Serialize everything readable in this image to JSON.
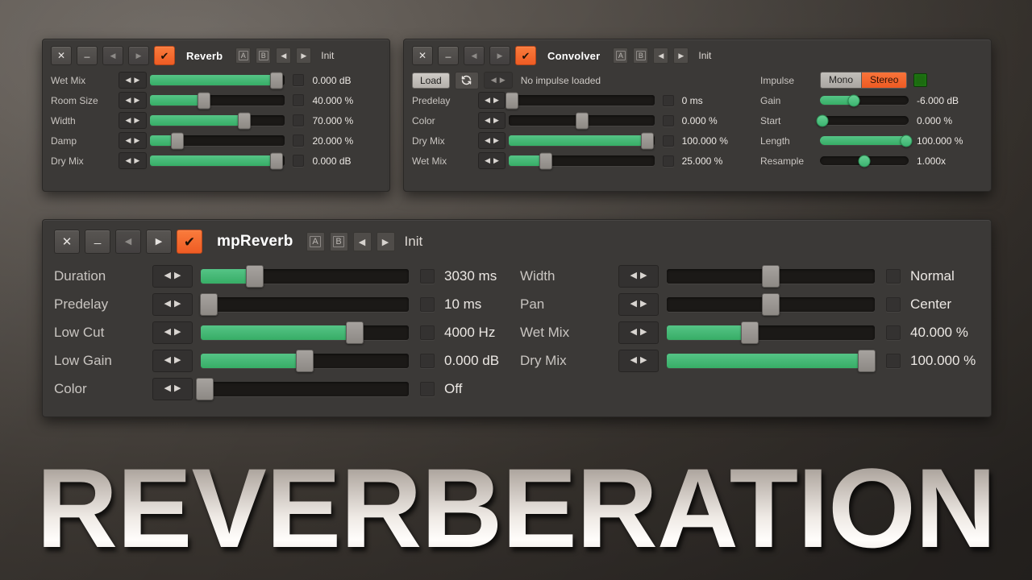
{
  "theme": {
    "accent_orange": "#ef5c24",
    "slider_green": "#3fb56e",
    "panel_bg": "#3b3937",
    "track_bg": "#1b1917",
    "led_green": "#1d6b10"
  },
  "hero": {
    "title": "REVERBERATION"
  },
  "panels": [
    {
      "id": "reverb",
      "name": "Reverb",
      "titlebar": {
        "close": "✕",
        "minimize": "_",
        "prev": "◀",
        "next": "▶",
        "enabled_check": "✔",
        "a_label": "A",
        "b_label": "B",
        "preset_prev": "◀",
        "preset_next": "▶",
        "preset_name": "Init"
      },
      "params": [
        {
          "label": "Wet Mix",
          "value": "0.000 dB",
          "fill_pct": 94,
          "thumb_pct": 94
        },
        {
          "label": "Room Size",
          "value": "40.000 %",
          "fill_pct": 40,
          "thumb_pct": 40
        },
        {
          "label": "Width",
          "value": "70.000 %",
          "fill_pct": 70,
          "thumb_pct": 70
        },
        {
          "label": "Damp",
          "value": "20.000 %",
          "fill_pct": 20,
          "thumb_pct": 20
        },
        {
          "label": "Dry Mix",
          "value": "0.000 dB",
          "fill_pct": 94,
          "thumb_pct": 94
        }
      ]
    },
    {
      "id": "convolver",
      "name": "Convolver",
      "titlebar": {
        "close": "✕",
        "minimize": "_",
        "prev": "◀",
        "next": "▶",
        "enabled_check": "✔",
        "a_label": "A",
        "b_label": "B",
        "preset_prev": "◀",
        "preset_next": "▶",
        "preset_name": "Init"
      },
      "load_row": {
        "load_label": "Load",
        "reload_icon": "reload-icon",
        "prev": "◀",
        "next": "▶",
        "impulse_status": "No impulse loaded"
      },
      "params": [
        {
          "label": "Predelay",
          "value": "0 ms",
          "fill_pct": 0,
          "thumb_pct": 2
        },
        {
          "label": "Color",
          "value": "0.000 %",
          "fill_pct": 0,
          "thumb_pct": 50
        },
        {
          "label": "Dry Mix",
          "value": "100.000 %",
          "fill_pct": 95,
          "thumb_pct": 95
        },
        {
          "label": "Wet Mix",
          "value": "25.000 %",
          "fill_pct": 25,
          "thumb_pct": 25
        }
      ],
      "impulse": {
        "label": "Impulse",
        "mono_label": "Mono",
        "stereo_label": "Stereo",
        "selected": "Stereo",
        "led": "stereo-led"
      },
      "right_params": [
        {
          "label": "Gain",
          "value": "-6.000 dB",
          "fill_pct": 38,
          "thumb_pct": 38
        },
        {
          "label": "Start",
          "value": "0.000 %",
          "fill_pct": 3,
          "thumb_pct": 3
        },
        {
          "label": "Length",
          "value": "100.000 %",
          "fill_pct": 97,
          "thumb_pct": 97
        },
        {
          "label": "Resample",
          "value": "1.000x",
          "fill_pct": 0,
          "thumb_pct": 50
        }
      ]
    },
    {
      "id": "mpreverb",
      "name": "mpReverb",
      "titlebar": {
        "close": "✕",
        "minimize": "_",
        "prev": "◀",
        "next": "▶",
        "enabled_check": "✔",
        "a_label": "A",
        "b_label": "B",
        "preset_prev": "◀",
        "preset_next": "▶",
        "preset_name": "Init"
      },
      "left_params": [
        {
          "label": "Duration",
          "value": "3030 ms",
          "fill_pct": 26,
          "thumb_pct": 26
        },
        {
          "label": "Predelay",
          "value": "10 ms",
          "fill_pct": 3,
          "thumb_pct": 4
        },
        {
          "label": "Low Cut",
          "value": "4000 Hz",
          "fill_pct": 74,
          "thumb_pct": 74
        },
        {
          "label": "Low Gain",
          "value": "0.000 dB",
          "fill_pct": 50,
          "thumb_pct": 50
        },
        {
          "label": "Color",
          "value": "Off",
          "fill_pct": 0,
          "thumb_pct": 2
        }
      ],
      "right_params": [
        {
          "label": "Width",
          "value": "Normal",
          "fill_pct": 0,
          "thumb_pct": 50
        },
        {
          "label": "Pan",
          "value": "Center",
          "fill_pct": 0,
          "thumb_pct": 50
        },
        {
          "label": "Wet Mix",
          "value": "40.000 %",
          "fill_pct": 40,
          "thumb_pct": 40
        },
        {
          "label": "Dry Mix",
          "value": "100.000 %",
          "fill_pct": 96,
          "thumb_pct": 96
        }
      ]
    }
  ]
}
